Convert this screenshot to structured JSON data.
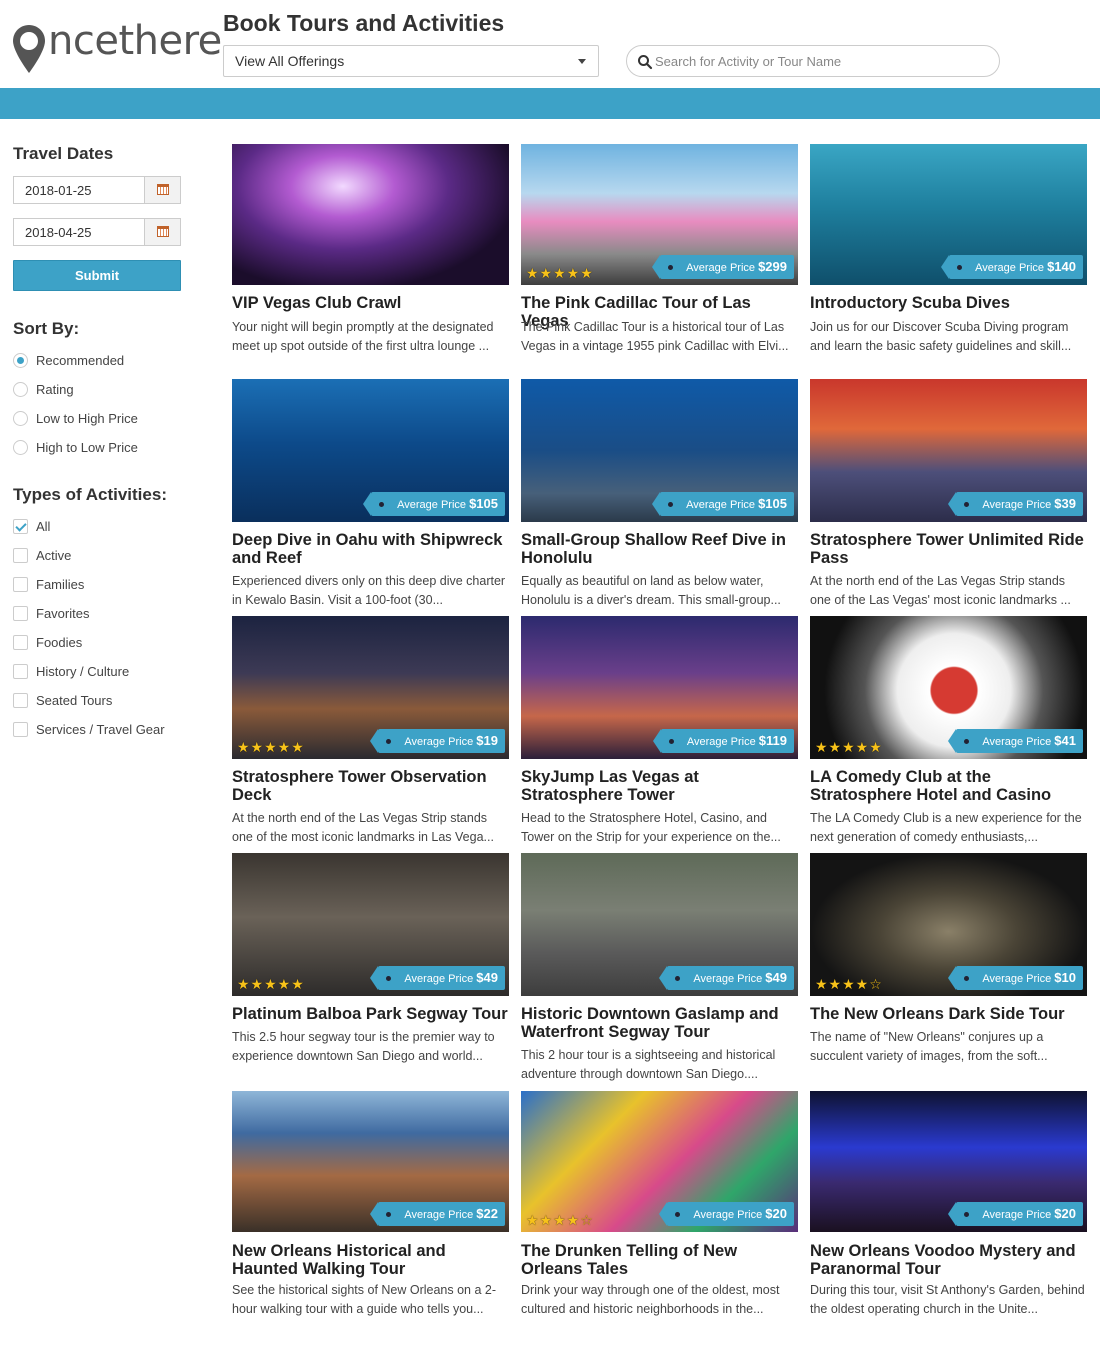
{
  "header": {
    "logo_text": "ncethere",
    "title": "Book Tours and Activities",
    "offerings_select": "View All Offerings",
    "search_placeholder": "Search for Activity or Tour Name"
  },
  "sidebar": {
    "travel_dates_heading": "Travel Dates",
    "start_date": "2018-01-25",
    "end_date": "2018-04-25",
    "submit_label": "Submit",
    "sort_heading": "Sort By:",
    "sort_options": [
      {
        "label": "Recommended",
        "selected": true
      },
      {
        "label": "Rating",
        "selected": false
      },
      {
        "label": "Low to High Price",
        "selected": false
      },
      {
        "label": "High to Low Price",
        "selected": false
      }
    ],
    "types_heading": "Types of Activities:",
    "types": [
      {
        "label": "All",
        "checked": true
      },
      {
        "label": "Active",
        "checked": false
      },
      {
        "label": "Families",
        "checked": false
      },
      {
        "label": "Favorites",
        "checked": false
      },
      {
        "label": "Foodies",
        "checked": false
      },
      {
        "label": "History / Culture",
        "checked": false
      },
      {
        "label": "Seated Tours",
        "checked": false
      },
      {
        "label": "Services / Travel Gear",
        "checked": false
      }
    ]
  },
  "price_label": "Average Price",
  "colors": {
    "accent": "#3da2c7",
    "star": "#f7c21a"
  },
  "cards": [
    {
      "title": "VIP Vegas Club Crawl",
      "price": "",
      "rating": 0,
      "desc": "Your night will begin promptly at the designated meet up spot outside of the first ultra lounge ..."
    },
    {
      "title": "The Pink Cadillac Tour of Las Vegas",
      "price": "$299",
      "rating": 5,
      "desc": "The Pink Cadillac Tour is a historical tour of Las Vegas in a vintage 1955 pink Cadillac with Elvi..."
    },
    {
      "title": "Introductory Scuba Dives",
      "price": "$140",
      "rating": 0,
      "desc": "Join us for our Discover Scuba Diving program and learn the basic safety guidelines and skill..."
    },
    {
      "title": "Deep Dive in Oahu with Shipwreck and Reef",
      "price": "$105",
      "rating": 0,
      "desc": "Experienced divers only on this deep dive charter in Kewalo Basin. Visit a 100-foot (30..."
    },
    {
      "title": "Small-Group Shallow Reef Dive in Honolulu",
      "price": "$105",
      "rating": 0,
      "desc": "Equally as beautiful on land as below water, Honolulu is a diver's dream. This small-group..."
    },
    {
      "title": "Stratosphere Tower Unlimited Ride Pass",
      "price": "$39",
      "rating": 0,
      "desc": "At the north end of the Las Vegas Strip stands one of the Las Vegas' most iconic landmarks ..."
    },
    {
      "title": "Stratosphere Tower Observation Deck",
      "price": "$19",
      "rating": 5,
      "desc": "At the north end of the Las Vegas Strip stands one of the most iconic landmarks in Las Vega..."
    },
    {
      "title": "SkyJump Las Vegas at Stratosphere Tower",
      "price": "$119",
      "rating": 0,
      "desc": "Head to the Stratosphere Hotel, Casino, and Tower on the Strip for your experience on the..."
    },
    {
      "title": "LA Comedy Club at the Stratosphere Hotel and Casino",
      "price": "$41",
      "rating": 5,
      "desc": "The LA Comedy Club is a new experience for the next generation of comedy enthusiasts,..."
    },
    {
      "title": "Platinum Balboa Park Segway Tour",
      "price": "$49",
      "rating": 5,
      "desc": "This 2.5 hour segway tour is the premier way to experience downtown San Diego and world..."
    },
    {
      "title": "Historic Downtown Gaslamp and Waterfront Segway Tour",
      "price": "$49",
      "rating": 0,
      "desc": "This 2 hour tour is a sightseeing and historical adventure through downtown San Diego...."
    },
    {
      "title": "The New Orleans Dark Side Tour",
      "price": "$10",
      "rating": 4,
      "desc": "The name of \"New Orleans\" conjures up a succulent variety of images, from the soft..."
    },
    {
      "title": "New Orleans Historical and Haunted Walking Tour",
      "price": "$22",
      "rating": 0,
      "desc": "See the historical sights of New Orleans on a 2-hour walking tour with a guide who tells you..."
    },
    {
      "title": "The Drunken Telling of New Orleans Tales",
      "price": "$20",
      "rating": 4,
      "desc": "Drink your way through one of the oldest, most cultured and historic neighborhoods in the..."
    },
    {
      "title": "New Orleans Voodoo Mystery and Paranormal Tour",
      "price": "$20",
      "rating": 0,
      "desc": "During this tour, visit St Anthony's Garden, behind the oldest operating church in the Unite..."
    }
  ]
}
